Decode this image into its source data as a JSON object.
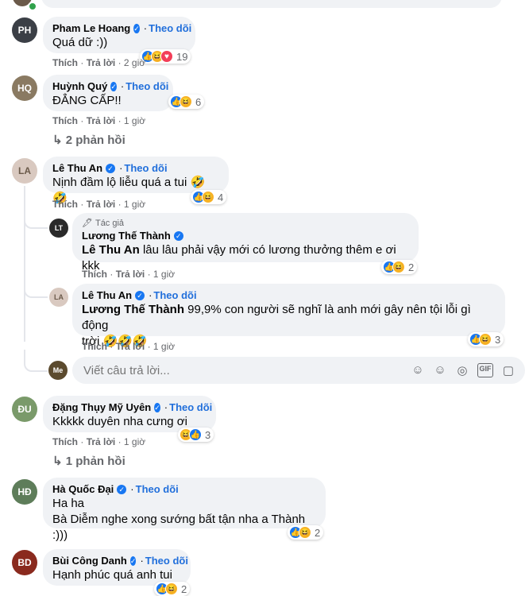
{
  "common": {
    "follow": "Theo dõi",
    "like": "Thích",
    "reply": "Trả lời",
    "sep": "·",
    "author_badge": "Tác giả",
    "reply_placeholder": "Viết câu trả lời..."
  },
  "comments": [
    {
      "name": "Pham Le Hoang",
      "text": "Quá dữ :))",
      "time": "2 giờ",
      "reaction_count": "19",
      "reactions": [
        "like-icon",
        "haha-icon",
        "love-icon"
      ]
    },
    {
      "name": "Huỳnh Quý",
      "text": "ĐẲNG CẤP!!",
      "time": "1 giờ",
      "reaction_count": "6",
      "reactions": [
        "like-icon",
        "haha-icon"
      ],
      "replies_label": "2 phản hồi"
    },
    {
      "name": "Lê Thu An",
      "text": "Nịnh đầm lộ liễu quá a tui 🤣🤣",
      "time": "1 giờ",
      "reaction_count": "4",
      "reactions": [
        "like-icon",
        "haha-icon"
      ]
    },
    {
      "name": "Đặng Thụy Mỹ Uyên",
      "text": "Kkkkk duyên nha cưng ơi",
      "time": "1 giờ",
      "reaction_count": "3",
      "reactions": [
        "haha-icon",
        "like-icon"
      ],
      "replies_label": "1 phản hồi"
    },
    {
      "name": "Hà Quốc Đại",
      "text_line1": "Ha ha",
      "text_line2": "Bà Diễm nghe xong sướng bất tận nha a Thành :)))",
      "reaction_count": "2",
      "reactions": [
        "like-icon",
        "haha-icon"
      ]
    },
    {
      "name": "Bùi Công Danh",
      "text": "Hạnh phúc quá anh tui",
      "reaction_count": "2",
      "reactions": [
        "like-icon",
        "haha-icon"
      ]
    }
  ],
  "replies": [
    {
      "name": "Lương Thế Thành",
      "mention": "Lê Thu An",
      "text": " lâu lâu phải vậy mới có lương thưởng thêm e ơi kkk",
      "time": "1 giờ",
      "reaction_count": "2",
      "reactions": [
        "like-icon",
        "haha-icon"
      ]
    },
    {
      "name": "Lê Thu An",
      "follow": true,
      "mention": "Lương Thế Thành",
      "text_line1": " 99,9% con người sẽ nghĩ là anh mới gây nên tội lỗi gì động",
      "text_line2": "trời 🤣🤣🤣",
      "time": "1 giờ",
      "reaction_count": "3",
      "reactions": [
        "like-icon",
        "haha-icon"
      ]
    }
  ],
  "colors": {
    "bubble": "#f0f2f5",
    "link": "#216fdb",
    "muted": "#65676b",
    "verified": "#1877f2"
  }
}
